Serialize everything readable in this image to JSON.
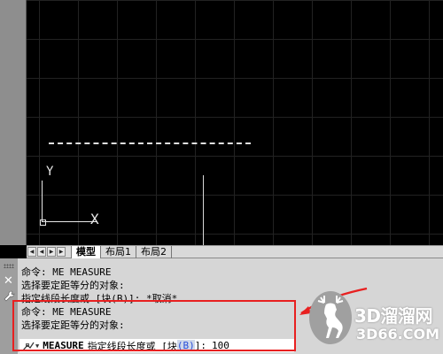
{
  "canvas": {
    "ucs_y_label": "Y",
    "ucs_x_label": "X"
  },
  "tabs": {
    "nav_first": "◀",
    "nav_prev": "◀",
    "nav_next": "▶",
    "nav_last": "▶",
    "items": [
      {
        "label": "模型",
        "active": true
      },
      {
        "label": "布局1",
        "active": false
      },
      {
        "label": "布局2",
        "active": false
      }
    ]
  },
  "command": {
    "history": [
      "命令: ME MEASURE",
      "选择要定距等分的对象:",
      "指定线段长度或 [块(B)]: *取消*",
      "命令: ME MEASURE",
      "选择要定距等分的对象:"
    ],
    "input": {
      "command_name": "MEASURE",
      "prompt_before": "指定线段长度或 [",
      "option_text": "块",
      "option_key": "(B)",
      "prompt_after": "]:",
      "value": "100"
    }
  },
  "watermark": {
    "brand": "3D溜溜网",
    "site": "3D66.COM"
  },
  "colors": {
    "canvas_bg": "#000000",
    "highlight": "#e82020",
    "option_key": "#2a4fd8"
  }
}
